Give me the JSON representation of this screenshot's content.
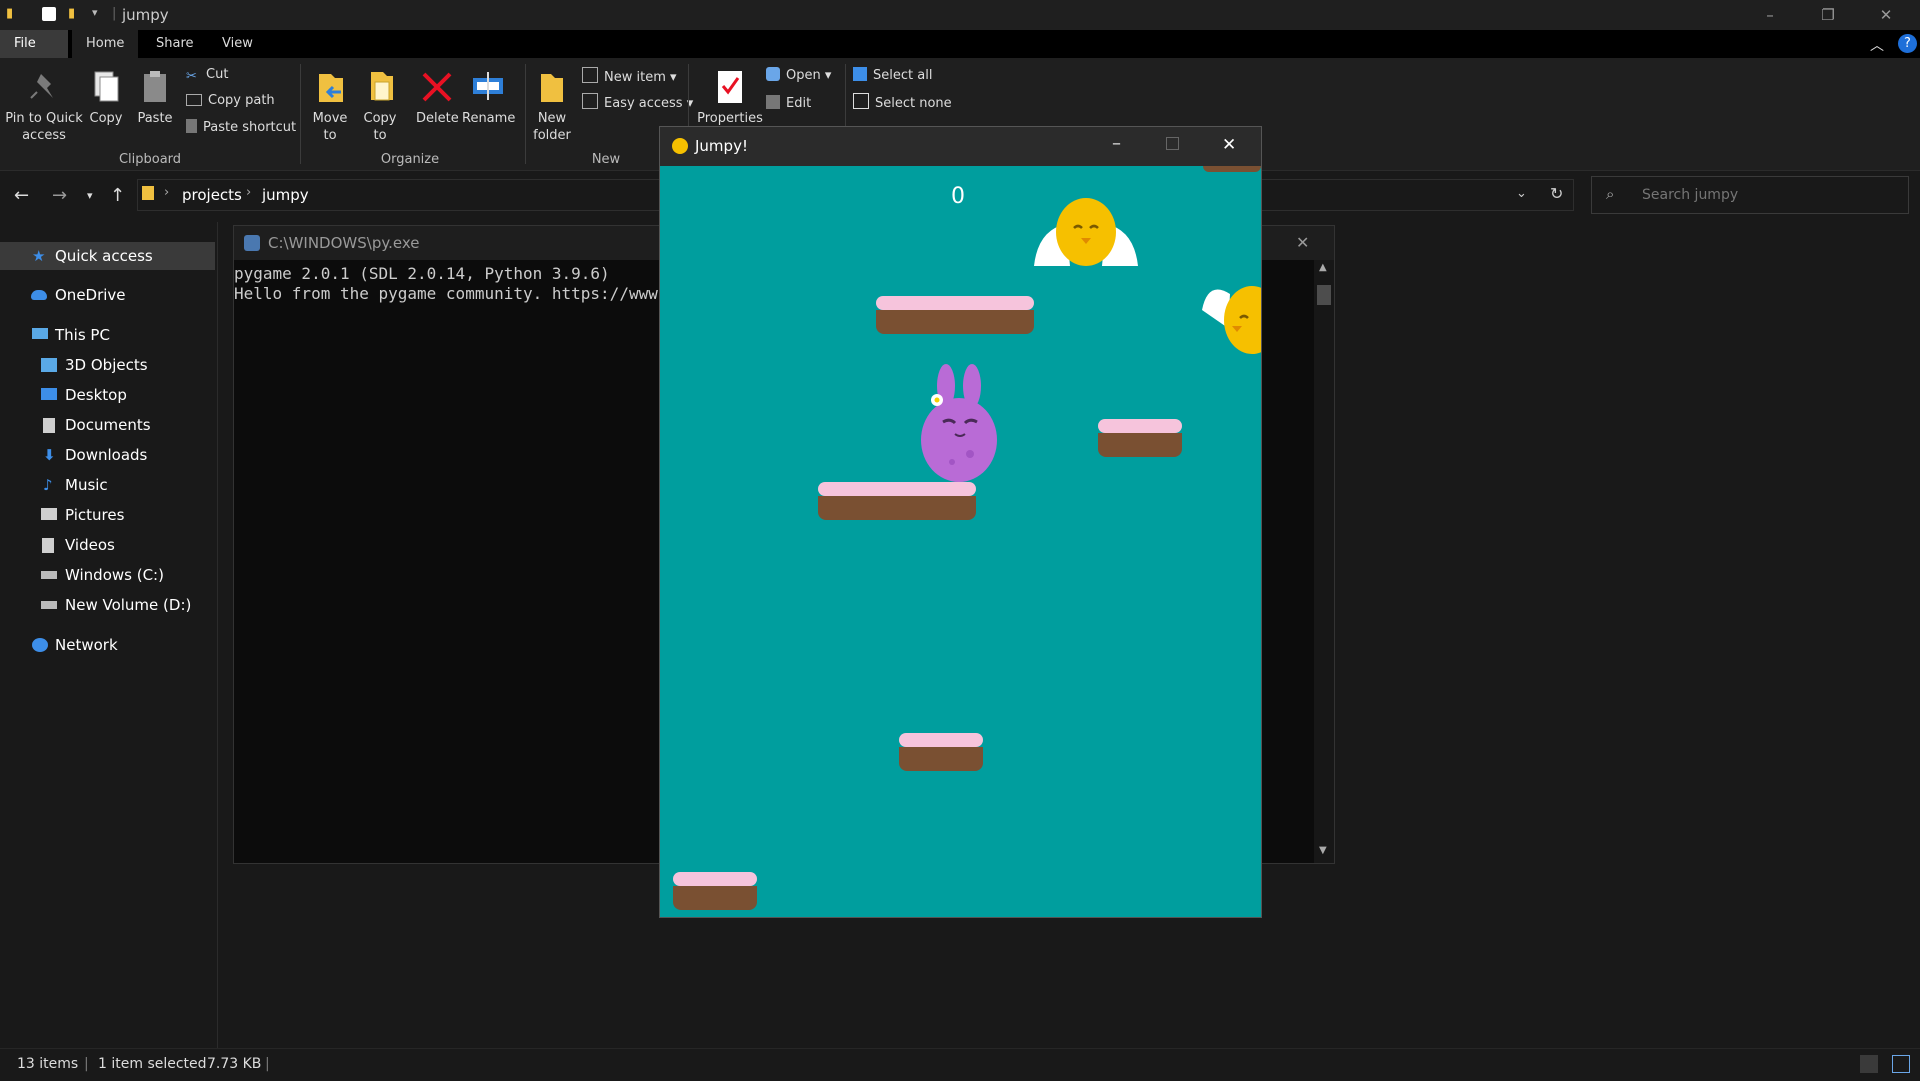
{
  "titlebar": {
    "title": "jumpy",
    "minimize": "–",
    "restore": "❐",
    "close": "✕"
  },
  "ribbon_tabs": [
    "File",
    "Home",
    "Share",
    "View"
  ],
  "ribbon": {
    "clipboard": {
      "pin_label": "Pin to Quick access",
      "copy_label": "Copy",
      "paste_label": "Paste",
      "cut_label": "Cut",
      "copy_path_label": "Copy path",
      "paste_shortcut_label": "Paste shortcut",
      "group_label": "Clipboard"
    },
    "organize": {
      "move_to_label": "Move to",
      "copy_to_label": "Copy to",
      "delete_label": "Delete",
      "rename_label": "Rename",
      "group_label": "Organize"
    },
    "new": {
      "new_folder_label": "New folder",
      "new_item_label": "New item",
      "easy_access_label": "Easy access",
      "group_label": "New"
    },
    "open": {
      "properties_label": "Properties",
      "open_label": "Open",
      "edit_label": "Edit"
    },
    "select": {
      "select_all_label": "Select all",
      "select_none_label": "Select none"
    }
  },
  "address": {
    "crumbs": [
      "projects",
      "jumpy"
    ],
    "search_placeholder": "Search jumpy"
  },
  "sidebar": {
    "items": [
      {
        "label": "Quick access",
        "icon": "star-icon",
        "color": "#3d8ee8"
      },
      {
        "label": "OneDrive",
        "icon": "cloud-icon",
        "color": "#3d8ee8"
      },
      {
        "label": "This PC",
        "icon": "computer-icon",
        "color": "#5aa9e6"
      },
      {
        "label": "3D Objects",
        "icon": "cube-icon",
        "color": "#5aa9e6"
      },
      {
        "label": "Desktop",
        "icon": "desktop-icon",
        "color": "#3d8ee8"
      },
      {
        "label": "Documents",
        "icon": "document-icon",
        "color": "#cfcfcf"
      },
      {
        "label": "Downloads",
        "icon": "download-icon",
        "color": "#3d8ee8"
      },
      {
        "label": "Music",
        "icon": "music-icon",
        "color": "#3d8ee8"
      },
      {
        "label": "Pictures",
        "icon": "picture-icon",
        "color": "#cfcfcf"
      },
      {
        "label": "Videos",
        "icon": "video-icon",
        "color": "#cfcfcf"
      },
      {
        "label": "Windows (C:)",
        "icon": "drive-icon",
        "color": "#bbbbbb"
      },
      {
        "label": "New Volume (D:)",
        "icon": "drive-icon",
        "color": "#bbbbbb"
      },
      {
        "label": "Network",
        "icon": "network-icon",
        "color": "#3d8ee8"
      }
    ]
  },
  "console": {
    "title": "C:\\WINDOWS\\py.exe",
    "lines": [
      "pygame 2.0.1 (SDL 2.0.14, Python 3.9.6)",
      "Hello from the pygame community. https://www.pyg"
    ]
  },
  "game": {
    "title": "Jumpy!",
    "score": "0",
    "colors": {
      "sky": "#009e9e",
      "frosting": "#f6c4dc",
      "dirt": "#7a5032",
      "bunny": "#b96bd6",
      "chick": "#f6c000"
    }
  },
  "status": {
    "items_count": "13 items",
    "selected": "1 item selected",
    "size": "7.73 KB"
  }
}
